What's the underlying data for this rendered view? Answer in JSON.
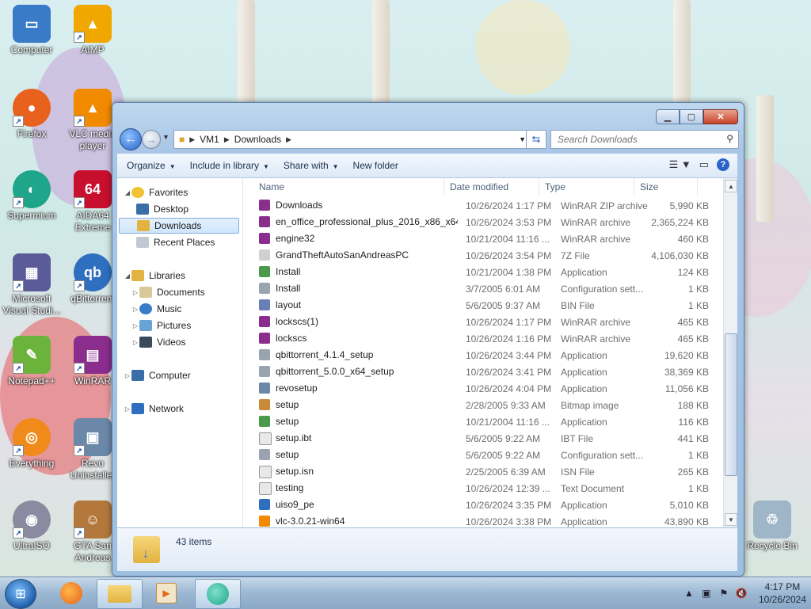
{
  "desktop": {
    "icons": [
      {
        "label": "Computer",
        "color": "#3a7bc8",
        "glyph": "▭"
      },
      {
        "label": "AIMP",
        "color": "#f0a800",
        "glyph": "▲"
      },
      {
        "label": "Firefox",
        "color": "#e8621d",
        "glyph": "●"
      },
      {
        "label": "VLC media player",
        "color": "#f28a00",
        "glyph": "▲"
      },
      {
        "label": "Supermium",
        "color": "#1fa58a",
        "glyph": "◐"
      },
      {
        "label": "AIDA64 Extreme",
        "color": "#c8102e",
        "glyph": "64"
      },
      {
        "label": "Microsoft Visual Studi...",
        "color": "#5b5b9a",
        "glyph": "▦"
      },
      {
        "label": "qBittorrent",
        "color": "#2f6fc0",
        "glyph": "qb"
      },
      {
        "label": "Notepad++",
        "color": "#6bb33a",
        "glyph": "✎"
      },
      {
        "label": "WinRAR",
        "color": "#8a2d8d",
        "glyph": "▤"
      },
      {
        "label": "Everything",
        "color": "#f08a1a",
        "glyph": "◎"
      },
      {
        "label": "Revo Uninstaller",
        "color": "#6b88a8",
        "glyph": "▣"
      },
      {
        "label": "UltraISO",
        "color": "#8a8aa0",
        "glyph": "◉"
      },
      {
        "label": "GTA San Andreas",
        "color": "#b4773c",
        "glyph": "☺"
      },
      {
        "label": "Recycle Bin",
        "color": "#9fb6c8",
        "glyph": "♲"
      }
    ]
  },
  "window": {
    "caption": {
      "minimize": "▁",
      "maximize": "▢",
      "close": "✕"
    },
    "address": {
      "segments": [
        "VM1",
        "Downloads"
      ]
    },
    "search": {
      "placeholder": "Search Downloads"
    },
    "commands": [
      "Organize",
      "Include in library",
      "Share with",
      "New folder"
    ],
    "nav": {
      "favorites": "Favorites",
      "desktop": "Desktop",
      "downloads": "Downloads",
      "recent": "Recent Places",
      "libraries": "Libraries",
      "documents": "Documents",
      "music": "Music",
      "pictures": "Pictures",
      "videos": "Videos",
      "computer": "Computer",
      "network": "Network"
    },
    "columns": {
      "name": "Name",
      "date": "Date modified",
      "type": "Type",
      "size": "Size"
    },
    "files": [
      {
        "name": "Downloads",
        "date": "10/26/2024 1:17 PM",
        "type": "WinRAR ZIP archive",
        "size": "5,990 KB",
        "icon": "#8a2d8d"
      },
      {
        "name": "en_office_professional_plus_2016_x86_x64...",
        "date": "10/26/2024 3:53 PM",
        "type": "WinRAR archive",
        "size": "2,365,224 KB",
        "icon": "#8a2d8d"
      },
      {
        "name": "engine32",
        "date": "10/21/2004 11:16 ...",
        "type": "WinRAR archive",
        "size": "460 KB",
        "icon": "#8a2d8d"
      },
      {
        "name": "GrandTheftAutoSanAndreasPC",
        "date": "10/26/2024 3:54 PM",
        "type": "7Z File",
        "size": "4,106,030 KB",
        "icon": "#d0d0d0"
      },
      {
        "name": "Install",
        "date": "10/21/2004 1:38 PM",
        "type": "Application",
        "size": "124 KB",
        "icon": "#4a9a4a"
      },
      {
        "name": "Install",
        "date": "3/7/2005 6:01 AM",
        "type": "Configuration sett...",
        "size": "1 KB",
        "icon": "#9aa4b0"
      },
      {
        "name": "layout",
        "date": "5/6/2005 9:37 AM",
        "type": "BIN File",
        "size": "1 KB",
        "icon": "#6a7fb8"
      },
      {
        "name": "lockscs(1)",
        "date": "10/26/2024 1:17 PM",
        "type": "WinRAR archive",
        "size": "465 KB",
        "icon": "#8a2d8d"
      },
      {
        "name": "lockscs",
        "date": "10/26/2024 1:16 PM",
        "type": "WinRAR archive",
        "size": "465 KB",
        "icon": "#8a2d8d"
      },
      {
        "name": "qbittorrent_4.1.4_setup",
        "date": "10/26/2024 3:44 PM",
        "type": "Application",
        "size": "19,620 KB",
        "icon": "#9aa4b0"
      },
      {
        "name": "qbittorrent_5.0.0_x64_setup",
        "date": "10/26/2024 3:41 PM",
        "type": "Application",
        "size": "38,369 KB",
        "icon": "#9aa4b0"
      },
      {
        "name": "revosetup",
        "date": "10/26/2024 4:04 PM",
        "type": "Application",
        "size": "11,056 KB",
        "icon": "#6b88a8"
      },
      {
        "name": "setup",
        "date": "2/28/2005 9:33 AM",
        "type": "Bitmap image",
        "size": "188 KB",
        "icon": "#c98a3a"
      },
      {
        "name": "setup",
        "date": "10/21/2004 11:16 ...",
        "type": "Application",
        "size": "116 KB",
        "icon": "#4a9a4a"
      },
      {
        "name": "setup.ibt",
        "date": "5/6/2005 9:22 AM",
        "type": "IBT File",
        "size": "441 KB",
        "icon": "#e8e8e8"
      },
      {
        "name": "setup",
        "date": "5/6/2005 9:22 AM",
        "type": "Configuration sett...",
        "size": "1 KB",
        "icon": "#9aa4b0"
      },
      {
        "name": "setup.isn",
        "date": "2/25/2005 6:39 AM",
        "type": "ISN File",
        "size": "265 KB",
        "icon": "#e8e8e8"
      },
      {
        "name": "testing",
        "date": "10/26/2024 12:39 ...",
        "type": "Text Document",
        "size": "1 KB",
        "icon": "#e8e8e8"
      },
      {
        "name": "uiso9_pe",
        "date": "10/26/2024 3:35 PM",
        "type": "Application",
        "size": "5,010 KB",
        "icon": "#2f6fc0"
      },
      {
        "name": "vlc-3.0.21-win64",
        "date": "10/26/2024 3:38 PM",
        "type": "Application",
        "size": "43,890 KB",
        "icon": "#f28a00"
      }
    ],
    "status": {
      "count": "43 items"
    }
  },
  "taskbar": {
    "time": "4:17 PM",
    "date": "10/26/2024"
  }
}
